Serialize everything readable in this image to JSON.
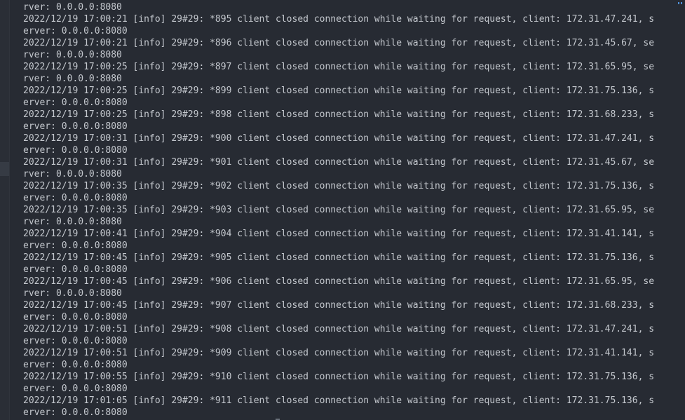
{
  "terminal": {
    "lines": [
      "rver: 0.0.0.0:8080",
      "2022/12/19 17:00:21 [info] 29#29: *895 client closed connection while waiting for request, client: 172.31.47.241, s",
      "erver: 0.0.0.0:8080",
      "2022/12/19 17:00:21 [info] 29#29: *896 client closed connection while waiting for request, client: 172.31.45.67, se",
      "rver: 0.0.0.0:8080",
      "2022/12/19 17:00:25 [info] 29#29: *897 client closed connection while waiting for request, client: 172.31.65.95, se",
      "rver: 0.0.0.0:8080",
      "2022/12/19 17:00:25 [info] 29#29: *899 client closed connection while waiting for request, client: 172.31.75.136, s",
      "erver: 0.0.0.0:8080",
      "2022/12/19 17:00:25 [info] 29#29: *898 client closed connection while waiting for request, client: 172.31.68.233, s",
      "erver: 0.0.0.0:8080",
      "2022/12/19 17:00:31 [info] 29#29: *900 client closed connection while waiting for request, client: 172.31.47.241, s",
      "erver: 0.0.0.0:8080",
      "2022/12/19 17:00:31 [info] 29#29: *901 client closed connection while waiting for request, client: 172.31.45.67, se",
      "rver: 0.0.0.0:8080",
      "2022/12/19 17:00:35 [info] 29#29: *902 client closed connection while waiting for request, client: 172.31.75.136, s",
      "erver: 0.0.0.0:8080",
      "2022/12/19 17:00:35 [info] 29#29: *903 client closed connection while waiting for request, client: 172.31.65.95, se",
      "rver: 0.0.0.0:8080",
      "2022/12/19 17:00:41 [info] 29#29: *904 client closed connection while waiting for request, client: 172.31.41.141, s",
      "erver: 0.0.0.0:8080",
      "2022/12/19 17:00:45 [info] 29#29: *905 client closed connection while waiting for request, client: 172.31.75.136, s",
      "erver: 0.0.0.0:8080",
      "2022/12/19 17:00:45 [info] 29#29: *906 client closed connection while waiting for request, client: 172.31.65.95, se",
      "rver: 0.0.0.0:8080",
      "2022/12/19 17:00:45 [info] 29#29: *907 client closed connection while waiting for request, client: 172.31.68.233, s",
      "erver: 0.0.0.0:8080",
      "2022/12/19 17:00:51 [info] 29#29: *908 client closed connection while waiting for request, client: 172.31.47.241, s",
      "erver: 0.0.0.0:8080",
      "2022/12/19 17:00:51 [info] 29#29: *909 client closed connection while waiting for request, client: 172.31.41.141, s",
      "erver: 0.0.0.0:8080",
      "2022/12/19 17:00:55 [info] 29#29: *910 client closed connection while waiting for request, client: 172.31.75.136, s",
      "erver: 0.0.0.0:8080",
      "2022/12/19 17:01:05 [info] 29#29: *911 client closed connection while waiting for request, client: 172.31.75.136, s",
      "erver: 0.0.0.0:8080"
    ]
  },
  "colors": {
    "background": "#272b33",
    "text": "#c4c8ce",
    "accent": "#4e8fd6"
  }
}
